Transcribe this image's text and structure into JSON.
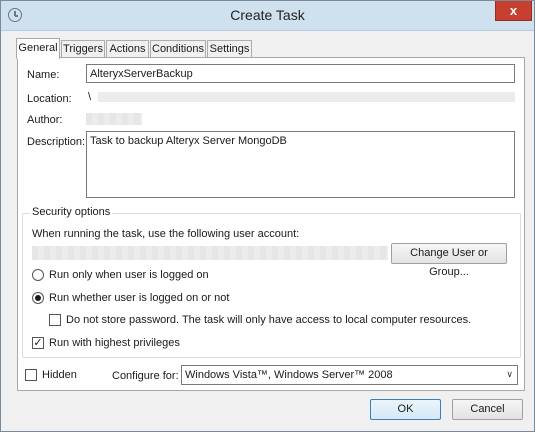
{
  "window": {
    "title": "Create Task",
    "close_glyph": "x",
    "app_icon": "clock-icon"
  },
  "tabs": [
    {
      "label": "General"
    },
    {
      "label": "Triggers"
    },
    {
      "label": "Actions"
    },
    {
      "label": "Conditions"
    },
    {
      "label": "Settings"
    }
  ],
  "general": {
    "name_label": "Name:",
    "name_value": "AlteryxServerBackup",
    "location_label": "Location:",
    "location_value": "\\",
    "author_label": "Author:",
    "description_label": "Description:",
    "description_value": "Task to backup Alteryx Server MongoDB"
  },
  "security": {
    "group_title": "Security options",
    "account_prompt": "When running the task, use the following user account:",
    "change_button": "Change User or Group...",
    "radio_logged_on": "Run only when user is logged on",
    "radio_whether": "Run whether user is logged on or not",
    "radio_selected": "whether",
    "no_store_password": "Do not store password.  The task will only have access to local computer resources.",
    "no_store_checked": false,
    "highest_privileges": "Run with highest privileges",
    "highest_checked": true,
    "check_glyph": "✓"
  },
  "bottom": {
    "hidden_label": "Hidden",
    "configure_label": "Configure for:",
    "configure_value": "Windows Vista™, Windows Server™ 2008",
    "arrow_glyph": "∨",
    "ok_label": "OK",
    "cancel_label": "Cancel"
  }
}
